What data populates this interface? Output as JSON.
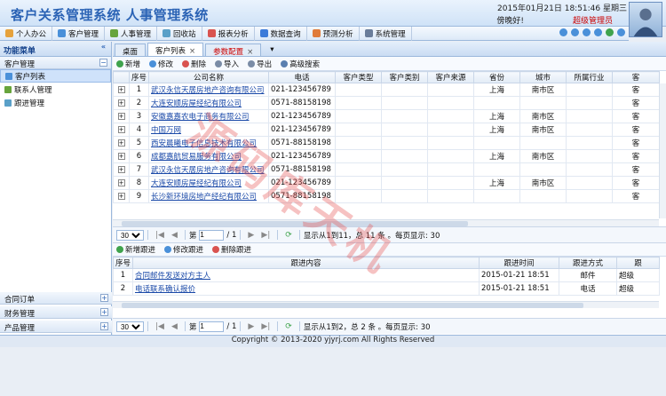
{
  "app": {
    "title": "客户关系管理系统 人事管理系统"
  },
  "header": {
    "datetime": "2015年01月21日 18:51:46 星期三",
    "greeting": "傍晚好!",
    "role": "超级管理员"
  },
  "menu": [
    {
      "label": "个人办公",
      "icon": "person-icon",
      "color": "#e6a23c"
    },
    {
      "label": "客户管理",
      "icon": "customer-icon",
      "color": "#4a90d9"
    },
    {
      "label": "人事管理",
      "icon": "hr-icon",
      "color": "#67a43c"
    },
    {
      "label": "回收站",
      "icon": "recycle-icon",
      "color": "#5aa0c8"
    },
    {
      "label": "报表分析",
      "icon": "report-icon",
      "color": "#d9534f"
    },
    {
      "label": "数据查询",
      "icon": "query-icon",
      "color": "#3c7bd9"
    },
    {
      "label": "预测分析",
      "icon": "forecast-icon",
      "color": "#e07b39"
    },
    {
      "label": "系统管理",
      "icon": "settings-icon",
      "color": "#6a7d9a"
    }
  ],
  "sidebar": {
    "header": "功能菜单",
    "section_top": "客户管理",
    "items": [
      {
        "label": "客户列表",
        "active": true
      },
      {
        "label": "联系人管理",
        "active": false
      },
      {
        "label": "跟进管理",
        "active": false
      }
    ],
    "sections_bottom": [
      "合同订单",
      "财务管理",
      "产品管理"
    ]
  },
  "tabs": [
    {
      "label": "桌面",
      "active": false,
      "red": false,
      "closable": false
    },
    {
      "label": "客户列表",
      "active": true,
      "red": false,
      "closable": true
    },
    {
      "label": "参数配置",
      "active": false,
      "red": true,
      "closable": true
    }
  ],
  "toolbar": {
    "add": "新增",
    "edit": "修改",
    "delete": "删除",
    "import": "导入",
    "export": "导出",
    "search": "高级搜索"
  },
  "customers": {
    "columns": [
      "",
      "序号",
      "公司名称",
      "电话",
      "客户类型",
      "客户类别",
      "客户来源",
      "省份",
      "城市",
      "所属行业",
      "客"
    ],
    "rows": [
      [
        "1",
        "武汉永信天居房地产咨询有限公司",
        "021-123456789",
        "",
        "",
        "",
        "上海",
        "南市区",
        "",
        "客"
      ],
      [
        "2",
        "大连安顺房屋经纪有限公司",
        "0571-88158198",
        "",
        "",
        "",
        "",
        "",
        "",
        "客"
      ],
      [
        "3",
        "安徽嘉嘉农电子商务有限公司",
        "021-123456789",
        "",
        "",
        "",
        "上海",
        "南市区",
        "",
        "客"
      ],
      [
        "4",
        "中国万网",
        "021-123456789",
        "",
        "",
        "",
        "上海",
        "南市区",
        "",
        "客"
      ],
      [
        "5",
        "西安晨曦电子信息技术有限公司",
        "0571-88158198",
        "",
        "",
        "",
        "",
        "",
        "",
        "客"
      ],
      [
        "6",
        "成都嘉航贸易服务有限公司",
        "021-123456789",
        "",
        "",
        "",
        "上海",
        "南市区",
        "",
        "客"
      ],
      [
        "7",
        "武汉永信天居房地产咨询有限公司",
        "0571-88158198",
        "",
        "",
        "",
        "",
        "",
        "",
        "客"
      ],
      [
        "8",
        "大连安顺房屋经纪有限公司",
        "021-123456789",
        "",
        "",
        "",
        "上海",
        "南市区",
        "",
        "客"
      ],
      [
        "9",
        "长沙新环境房地产经纪有限公司",
        "0571-88158198",
        "",
        "",
        "",
        "",
        "",
        "",
        "客"
      ]
    ]
  },
  "pager1": {
    "page_size": "30",
    "page": "1",
    "total_pages": "/ 1",
    "info": "显示从1到11，总 11 条 。每页显示: 30"
  },
  "followup_toolbar": {
    "add": "新增跟进",
    "edit": "修改跟进",
    "delete": "删除跟进"
  },
  "followups": {
    "columns": [
      "序号",
      "跟进内容",
      "跟进时间",
      "跟进方式",
      "跟"
    ],
    "rows": [
      [
        "1",
        "合同邮件发送对方主人",
        "2015-01-21 18:51",
        "邮件",
        "超级"
      ],
      [
        "2",
        "电话联系确认报价",
        "2015-01-21 18:51",
        "电话",
        "超级"
      ]
    ]
  },
  "pager2": {
    "page_size": "30",
    "page": "1",
    "total_pages": "/ 1",
    "info": "显示从1到2，总 2 条 。每页显示: 30"
  },
  "footer": {
    "copyright": "Copyright © 2013-2020 yjyrj.com All Rights Reserved"
  },
  "watermark": {
    "text": "源码库天机"
  }
}
